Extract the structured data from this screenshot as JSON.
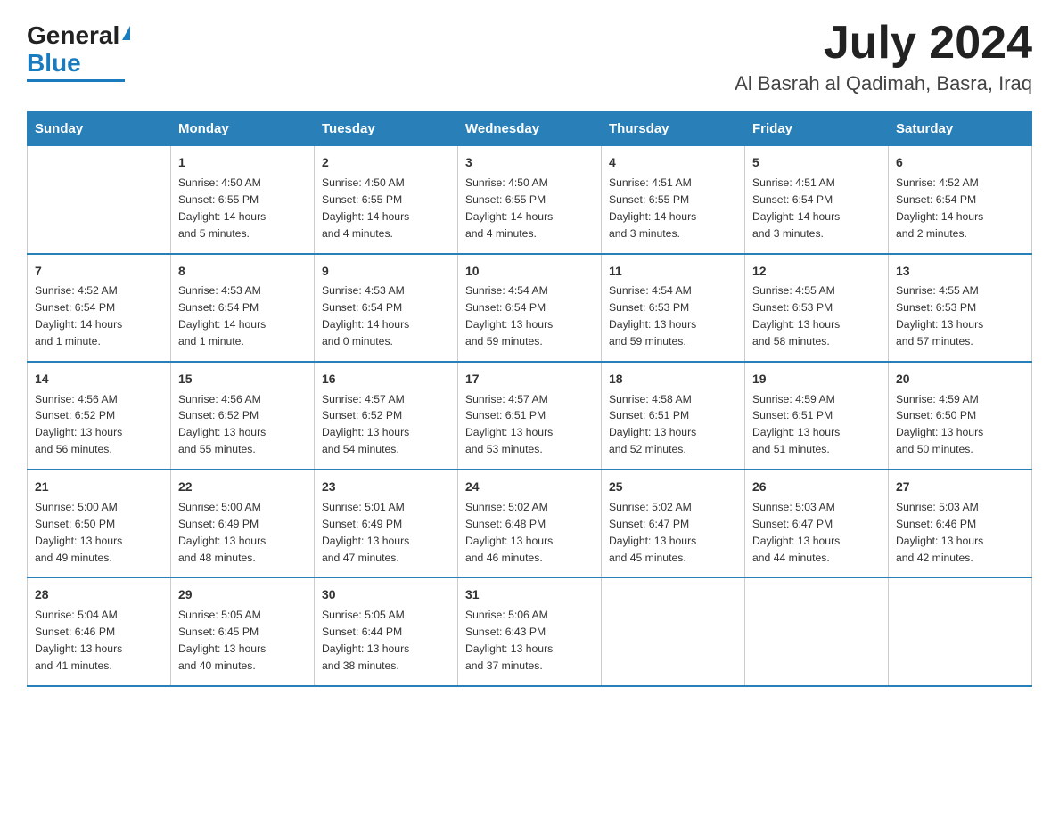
{
  "header": {
    "logo_general": "General",
    "logo_blue": "Blue",
    "month_title": "July 2024",
    "location": "Al Basrah al Qadimah, Basra, Iraq"
  },
  "days_of_week": [
    "Sunday",
    "Monday",
    "Tuesday",
    "Wednesday",
    "Thursday",
    "Friday",
    "Saturday"
  ],
  "weeks": [
    [
      {
        "day": "",
        "info": ""
      },
      {
        "day": "1",
        "info": "Sunrise: 4:50 AM\nSunset: 6:55 PM\nDaylight: 14 hours\nand 5 minutes."
      },
      {
        "day": "2",
        "info": "Sunrise: 4:50 AM\nSunset: 6:55 PM\nDaylight: 14 hours\nand 4 minutes."
      },
      {
        "day": "3",
        "info": "Sunrise: 4:50 AM\nSunset: 6:55 PM\nDaylight: 14 hours\nand 4 minutes."
      },
      {
        "day": "4",
        "info": "Sunrise: 4:51 AM\nSunset: 6:55 PM\nDaylight: 14 hours\nand 3 minutes."
      },
      {
        "day": "5",
        "info": "Sunrise: 4:51 AM\nSunset: 6:54 PM\nDaylight: 14 hours\nand 3 minutes."
      },
      {
        "day": "6",
        "info": "Sunrise: 4:52 AM\nSunset: 6:54 PM\nDaylight: 14 hours\nand 2 minutes."
      }
    ],
    [
      {
        "day": "7",
        "info": "Sunrise: 4:52 AM\nSunset: 6:54 PM\nDaylight: 14 hours\nand 1 minute."
      },
      {
        "day": "8",
        "info": "Sunrise: 4:53 AM\nSunset: 6:54 PM\nDaylight: 14 hours\nand 1 minute."
      },
      {
        "day": "9",
        "info": "Sunrise: 4:53 AM\nSunset: 6:54 PM\nDaylight: 14 hours\nand 0 minutes."
      },
      {
        "day": "10",
        "info": "Sunrise: 4:54 AM\nSunset: 6:54 PM\nDaylight: 13 hours\nand 59 minutes."
      },
      {
        "day": "11",
        "info": "Sunrise: 4:54 AM\nSunset: 6:53 PM\nDaylight: 13 hours\nand 59 minutes."
      },
      {
        "day": "12",
        "info": "Sunrise: 4:55 AM\nSunset: 6:53 PM\nDaylight: 13 hours\nand 58 minutes."
      },
      {
        "day": "13",
        "info": "Sunrise: 4:55 AM\nSunset: 6:53 PM\nDaylight: 13 hours\nand 57 minutes."
      }
    ],
    [
      {
        "day": "14",
        "info": "Sunrise: 4:56 AM\nSunset: 6:52 PM\nDaylight: 13 hours\nand 56 minutes."
      },
      {
        "day": "15",
        "info": "Sunrise: 4:56 AM\nSunset: 6:52 PM\nDaylight: 13 hours\nand 55 minutes."
      },
      {
        "day": "16",
        "info": "Sunrise: 4:57 AM\nSunset: 6:52 PM\nDaylight: 13 hours\nand 54 minutes."
      },
      {
        "day": "17",
        "info": "Sunrise: 4:57 AM\nSunset: 6:51 PM\nDaylight: 13 hours\nand 53 minutes."
      },
      {
        "day": "18",
        "info": "Sunrise: 4:58 AM\nSunset: 6:51 PM\nDaylight: 13 hours\nand 52 minutes."
      },
      {
        "day": "19",
        "info": "Sunrise: 4:59 AM\nSunset: 6:51 PM\nDaylight: 13 hours\nand 51 minutes."
      },
      {
        "day": "20",
        "info": "Sunrise: 4:59 AM\nSunset: 6:50 PM\nDaylight: 13 hours\nand 50 minutes."
      }
    ],
    [
      {
        "day": "21",
        "info": "Sunrise: 5:00 AM\nSunset: 6:50 PM\nDaylight: 13 hours\nand 49 minutes."
      },
      {
        "day": "22",
        "info": "Sunrise: 5:00 AM\nSunset: 6:49 PM\nDaylight: 13 hours\nand 48 minutes."
      },
      {
        "day": "23",
        "info": "Sunrise: 5:01 AM\nSunset: 6:49 PM\nDaylight: 13 hours\nand 47 minutes."
      },
      {
        "day": "24",
        "info": "Sunrise: 5:02 AM\nSunset: 6:48 PM\nDaylight: 13 hours\nand 46 minutes."
      },
      {
        "day": "25",
        "info": "Sunrise: 5:02 AM\nSunset: 6:47 PM\nDaylight: 13 hours\nand 45 minutes."
      },
      {
        "day": "26",
        "info": "Sunrise: 5:03 AM\nSunset: 6:47 PM\nDaylight: 13 hours\nand 44 minutes."
      },
      {
        "day": "27",
        "info": "Sunrise: 5:03 AM\nSunset: 6:46 PM\nDaylight: 13 hours\nand 42 minutes."
      }
    ],
    [
      {
        "day": "28",
        "info": "Sunrise: 5:04 AM\nSunset: 6:46 PM\nDaylight: 13 hours\nand 41 minutes."
      },
      {
        "day": "29",
        "info": "Sunrise: 5:05 AM\nSunset: 6:45 PM\nDaylight: 13 hours\nand 40 minutes."
      },
      {
        "day": "30",
        "info": "Sunrise: 5:05 AM\nSunset: 6:44 PM\nDaylight: 13 hours\nand 38 minutes."
      },
      {
        "day": "31",
        "info": "Sunrise: 5:06 AM\nSunset: 6:43 PM\nDaylight: 13 hours\nand 37 minutes."
      },
      {
        "day": "",
        "info": ""
      },
      {
        "day": "",
        "info": ""
      },
      {
        "day": "",
        "info": ""
      }
    ]
  ]
}
